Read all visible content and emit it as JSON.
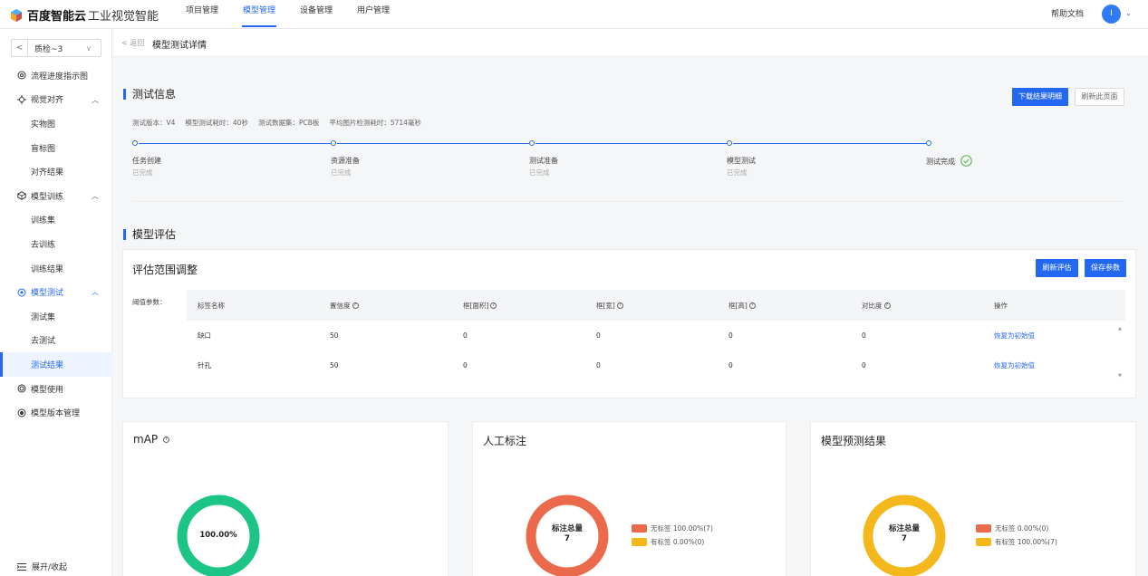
{
  "brand": {
    "name": "百度智能云",
    "product": "工业视觉智能"
  },
  "nav": [
    {
      "label": "项目管理"
    },
    {
      "label": "模型管理",
      "active": true
    },
    {
      "label": "设备管理"
    },
    {
      "label": "用户管理"
    }
  ],
  "header": {
    "help": "帮助文档",
    "avatar": "I"
  },
  "sidebar": {
    "project": "质检~3",
    "prev": "<",
    "items": [
      {
        "label": "流程进度指示图",
        "icon": "flow-icon"
      },
      {
        "label": "视觉对齐",
        "icon": "align-icon",
        "expanded": true
      },
      {
        "label": "实物图"
      },
      {
        "label": "盲标图"
      },
      {
        "label": "对齐结果"
      },
      {
        "label": "模型训练",
        "icon": "train-icon",
        "expanded": true
      },
      {
        "label": "训练集"
      },
      {
        "label": "去训练"
      },
      {
        "label": "训练结果"
      },
      {
        "label": "模型测试",
        "icon": "test-icon",
        "expanded": true,
        "active": true
      },
      {
        "label": "测试集"
      },
      {
        "label": "去测试"
      },
      {
        "label": "测试结果",
        "selected": true
      },
      {
        "label": "模型使用",
        "icon": "use-icon"
      },
      {
        "label": "模型版本管理",
        "icon": "version-icon"
      }
    ],
    "collapse": "展开/收起"
  },
  "breadcrumb": {
    "back": "< 返回",
    "title": "模型测试详情"
  },
  "test_info": {
    "title": "测试信息",
    "download_btn": "下载结果明细",
    "refresh_btn": "刷新此页面",
    "meta": [
      "测试版本：V4",
      "模型测试耗时：40秒",
      "测试数据集：PCB板",
      "平均图片检测耗时：5714毫秒"
    ],
    "steps": [
      {
        "title": "任务创建",
        "status": "已完成"
      },
      {
        "title": "资源准备",
        "status": "已完成"
      },
      {
        "title": "测试准备",
        "status": "已完成"
      },
      {
        "title": "模型测试",
        "status": "已完成"
      },
      {
        "title": "测试完成",
        "status": ""
      }
    ]
  },
  "evaluation": {
    "title": "模型评估",
    "card_title": "评估范围调整",
    "refresh_btn": "刷新评估",
    "save_btn": "保存参数",
    "threshold_label": "阈值参数：",
    "columns": [
      "标签名称",
      "置信度",
      "框[面积]",
      "框[宽]",
      "框[高]",
      "对比度",
      "操作"
    ],
    "rows": [
      {
        "cells": [
          "缺口",
          "50",
          "0",
          "0",
          "0",
          "0"
        ],
        "action": "恢复为初始值"
      },
      {
        "cells": [
          "针孔",
          "50",
          "0",
          "0",
          "0",
          "0"
        ],
        "action": "恢复为初始值"
      }
    ]
  },
  "charts": {
    "map": {
      "title": "mAP",
      "value": "100.00%",
      "color": "#1cc485"
    },
    "manual": {
      "title": "人工标注",
      "center_label": "标注总量",
      "center_value": "7",
      "legend": [
        {
          "label": "无标签 100.00%(7)",
          "color": "#ec6a4c"
        },
        {
          "label": "有标签 0.00%(0)",
          "color": "#f5b81c"
        }
      ]
    },
    "predict": {
      "title": "模型预测结果",
      "center_label": "标注总量",
      "center_value": "7",
      "legend": [
        {
          "label": "无标签 0.00%(0)",
          "color": "#ec6a4c"
        },
        {
          "label": "有标签 100.00%(7)",
          "color": "#f5b81c"
        }
      ]
    }
  }
}
